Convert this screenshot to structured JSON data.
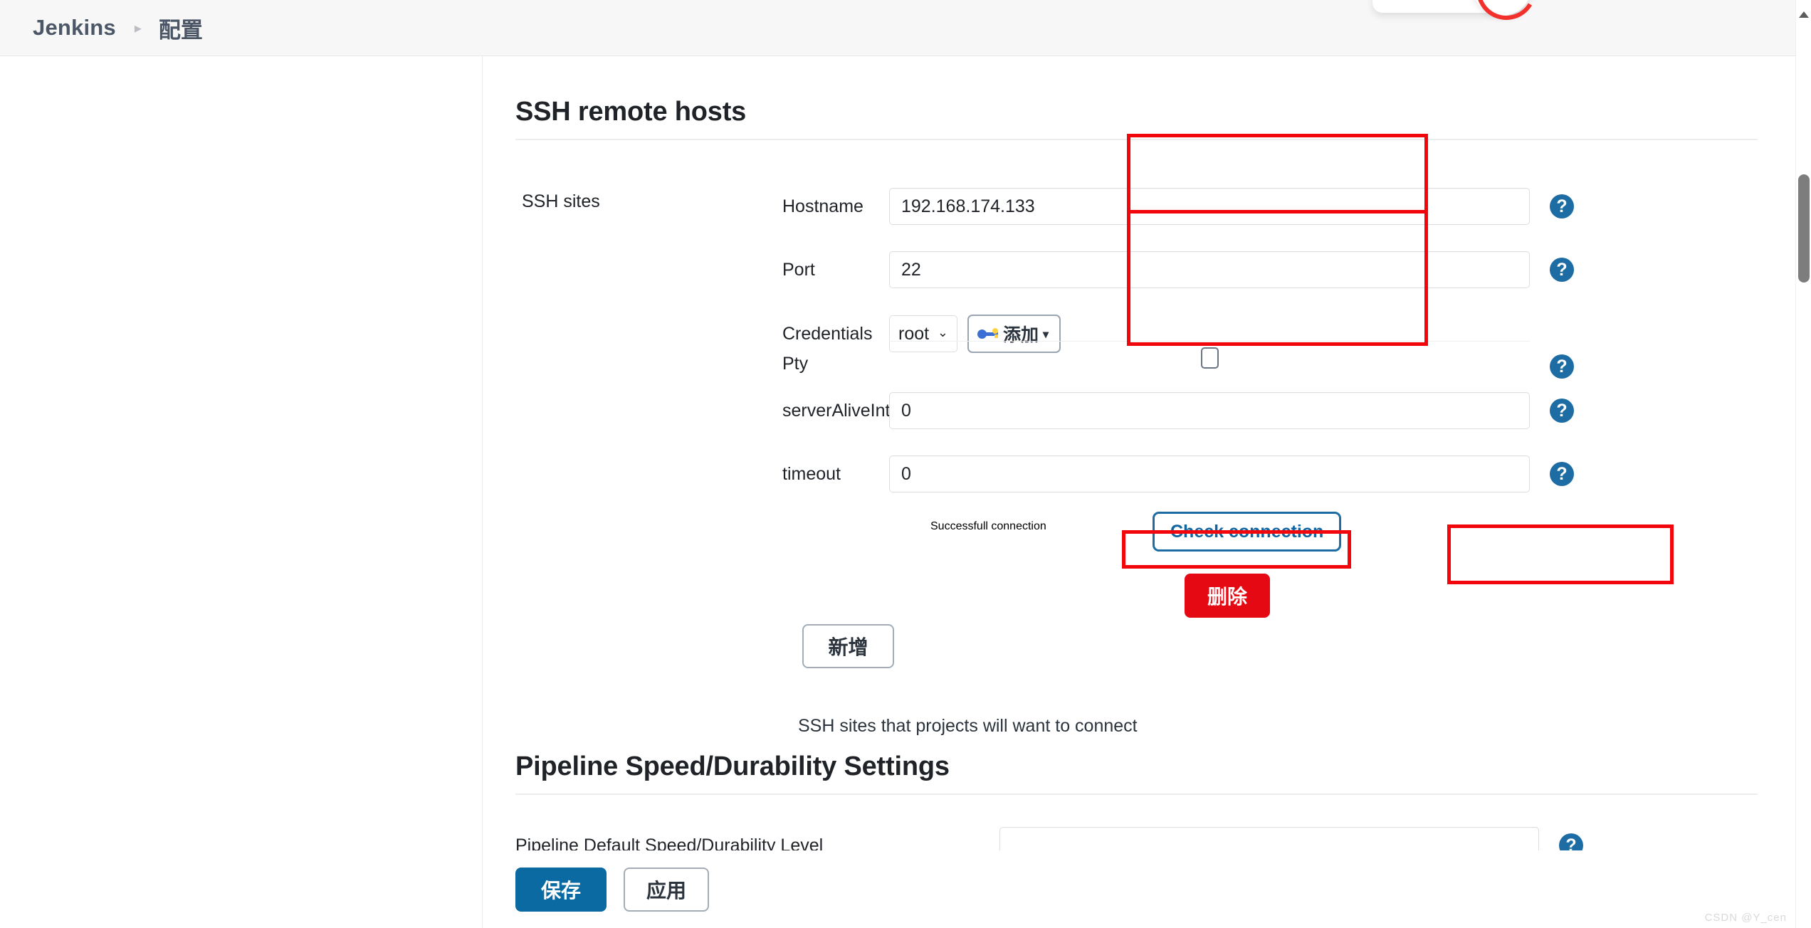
{
  "breadcrumb": {
    "root": "Jenkins",
    "separator": "▸",
    "current": "配置"
  },
  "sections": {
    "ssh": {
      "title": "SSH remote hosts",
      "group_label": "SSH sites",
      "fields": {
        "hostname": {
          "label": "Hostname",
          "value": "192.168.174.133",
          "help": "?"
        },
        "port": {
          "label": "Port",
          "value": "22",
          "help": "?"
        },
        "credentials": {
          "label": "Credentials",
          "selected": "root",
          "options": [
            "root"
          ],
          "caret": "⌄",
          "add_button": "添加",
          "add_caret": "▾",
          "add_icon": "key-icon"
        },
        "pty": {
          "label": "Pty",
          "checked": false,
          "help": "?"
        },
        "server_alive_interval": {
          "label": "serverAliveInterval",
          "value": "0",
          "help": "?"
        },
        "timeout": {
          "label": "timeout",
          "value": "0",
          "help": "?"
        }
      },
      "connection_status": "Successfull connection",
      "check_button": "Check connection",
      "delete_button": "删除",
      "add_button": "新增",
      "hint": "SSH sites that projects will want to connect"
    },
    "pipeline": {
      "title": "Pipeline Speed/Durability Settings",
      "row_label": "Pipeline Default Speed/Durability Level"
    }
  },
  "footer": {
    "save": "保存",
    "apply": "应用"
  },
  "watermark": "CSDN @Y_cen"
}
